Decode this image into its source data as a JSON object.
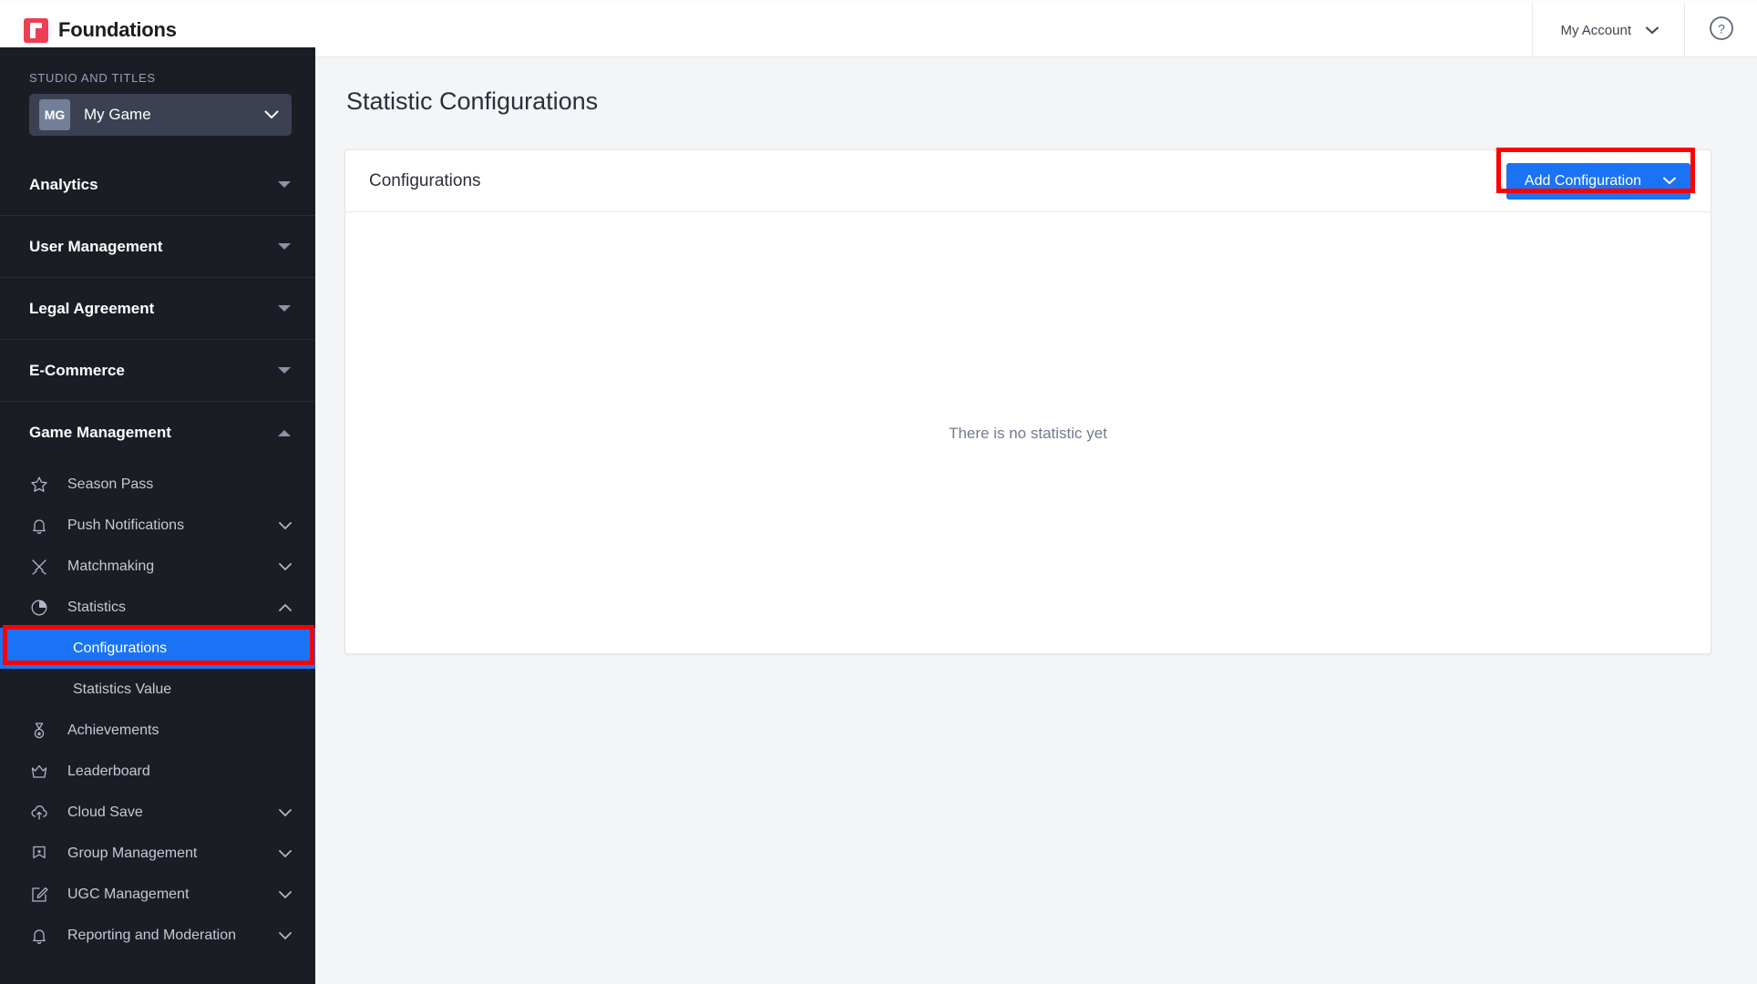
{
  "header": {
    "brand": "Foundations",
    "brand_mark_color": "#ee3e54",
    "account_label": "My Account",
    "account_chevron_icon": "chevron-down-icon",
    "help_icon": "help-circle-icon"
  },
  "sidebar": {
    "studio_label": "STUDIO AND TITLES",
    "studio": {
      "badge": "MG",
      "name": "My Game",
      "chevron_icon": "chevron-down-icon"
    },
    "sections": [
      {
        "label": "Analytics",
        "expanded": false,
        "chevron_icon": "chevron-down-icon"
      },
      {
        "label": "User Management",
        "expanded": false,
        "chevron_icon": "chevron-down-icon"
      },
      {
        "label": "Legal Agreement",
        "expanded": false,
        "chevron_icon": "chevron-down-icon"
      },
      {
        "label": "E-Commerce",
        "expanded": false,
        "chevron_icon": "chevron-down-icon"
      },
      {
        "label": "Game Management",
        "expanded": true,
        "chevron_icon": "chevron-up-icon"
      }
    ],
    "game_management_items": [
      {
        "label": "Season Pass",
        "icon": "star-icon",
        "chevron": ""
      },
      {
        "label": "Push Notifications",
        "icon": "bell-icon",
        "chevron": "chevron-down-icon"
      },
      {
        "label": "Matchmaking",
        "icon": "crossed-swords-icon",
        "chevron": "chevron-down-icon"
      },
      {
        "label": "Statistics",
        "icon": "pie-chart-icon",
        "chevron": "chevron-up-icon"
      }
    ],
    "statistics_subitems": [
      {
        "label": "Configurations",
        "active": true
      },
      {
        "label": "Statistics Value",
        "active": false
      }
    ],
    "game_management_items_after": [
      {
        "label": "Achievements",
        "icon": "medal-icon",
        "chevron": ""
      },
      {
        "label": "Leaderboard",
        "icon": "crown-icon",
        "chevron": ""
      },
      {
        "label": "Cloud Save",
        "icon": "cloud-upload-icon",
        "chevron": "chevron-down-icon"
      },
      {
        "label": "Group Management",
        "icon": "banner-icon",
        "chevron": "chevron-down-icon"
      },
      {
        "label": "UGC Management",
        "icon": "edit-square-icon",
        "chevron": "chevron-down-icon"
      },
      {
        "label": "Reporting and Moderation",
        "icon": "bell-icon",
        "chevron": "chevron-down-icon"
      }
    ],
    "active_item_color": "#1a73f5"
  },
  "main": {
    "page_title": "Statistic Configurations",
    "card": {
      "title": "Configurations",
      "add_button_label": "Add Configuration",
      "add_button_chevron_icon": "chevron-down-icon",
      "empty_text": "There is no statistic yet"
    }
  },
  "annotations": {
    "color": "#ff0000",
    "targets": [
      "sidebar-item-configurations",
      "add-configuration-button"
    ]
  }
}
